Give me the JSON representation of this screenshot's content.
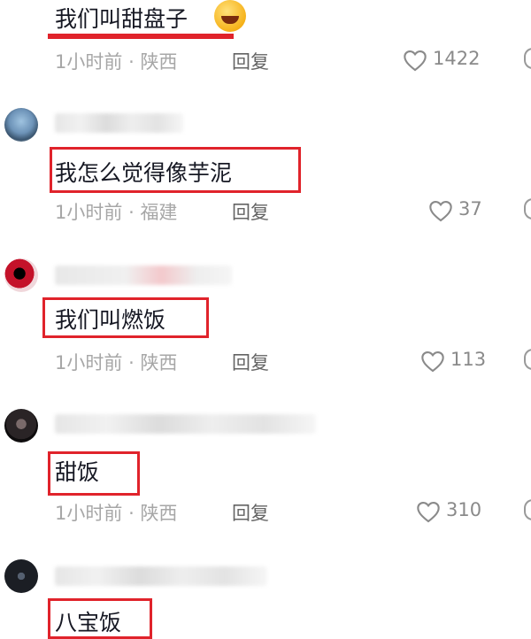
{
  "comments": [
    {
      "text": "我们叫甜盘子",
      "time": "1小时前",
      "location": "陕西",
      "reply": "回复",
      "likes": "1422"
    },
    {
      "text": "我怎么觉得像芋泥",
      "time": "1小时前",
      "location": "福建",
      "reply": "回复",
      "likes": "37"
    },
    {
      "text": "我们叫燃饭",
      "time": "1小时前",
      "location": "陕西",
      "reply": "回复",
      "likes": "113"
    },
    {
      "text": "甜饭",
      "time": "1小时前",
      "location": "陕西",
      "reply": "回复",
      "likes": "310"
    },
    {
      "text": "八宝饭"
    }
  ],
  "separator": "·",
  "icons": {
    "like": "heart-outline-icon",
    "emoji": "laughing-tears-emoji"
  },
  "colors": {
    "highlight": "#e0232b",
    "meta": "#a7a7a7",
    "text": "#161823"
  }
}
